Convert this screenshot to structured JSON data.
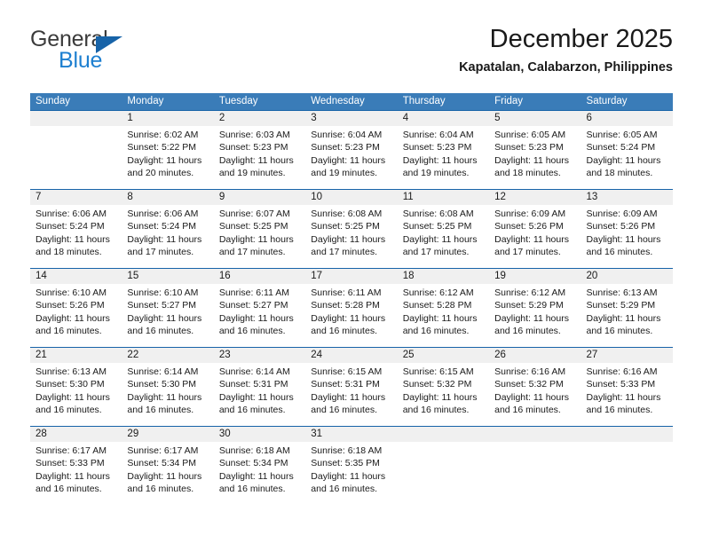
{
  "brand": {
    "name_part1": "General",
    "name_part2": "Blue",
    "logo_icon": "blue-triangle-flag-icon",
    "accent_color": "#1763a8",
    "blue_text_color": "#1d7fd0"
  },
  "header": {
    "title": "December 2025",
    "subtitle": "Kapatalan, Calabarzon, Philippines"
  },
  "calendar": {
    "header_bg_color": "#3a7cb8",
    "row_divider_color": "#1763a8",
    "daynum_bg_color": "#f0f0f0",
    "weekdays": [
      "Sunday",
      "Monday",
      "Tuesday",
      "Wednesday",
      "Thursday",
      "Friday",
      "Saturday"
    ],
    "weeks": [
      [
        {
          "day": "",
          "sunrise": "",
          "sunset": "",
          "daylight1": "",
          "daylight2": ""
        },
        {
          "day": "1",
          "sunrise": "Sunrise: 6:02 AM",
          "sunset": "Sunset: 5:22 PM",
          "daylight1": "Daylight: 11 hours",
          "daylight2": "and 20 minutes."
        },
        {
          "day": "2",
          "sunrise": "Sunrise: 6:03 AM",
          "sunset": "Sunset: 5:23 PM",
          "daylight1": "Daylight: 11 hours",
          "daylight2": "and 19 minutes."
        },
        {
          "day": "3",
          "sunrise": "Sunrise: 6:04 AM",
          "sunset": "Sunset: 5:23 PM",
          "daylight1": "Daylight: 11 hours",
          "daylight2": "and 19 minutes."
        },
        {
          "day": "4",
          "sunrise": "Sunrise: 6:04 AM",
          "sunset": "Sunset: 5:23 PM",
          "daylight1": "Daylight: 11 hours",
          "daylight2": "and 19 minutes."
        },
        {
          "day": "5",
          "sunrise": "Sunrise: 6:05 AM",
          "sunset": "Sunset: 5:23 PM",
          "daylight1": "Daylight: 11 hours",
          "daylight2": "and 18 minutes."
        },
        {
          "day": "6",
          "sunrise": "Sunrise: 6:05 AM",
          "sunset": "Sunset: 5:24 PM",
          "daylight1": "Daylight: 11 hours",
          "daylight2": "and 18 minutes."
        }
      ],
      [
        {
          "day": "7",
          "sunrise": "Sunrise: 6:06 AM",
          "sunset": "Sunset: 5:24 PM",
          "daylight1": "Daylight: 11 hours",
          "daylight2": "and 18 minutes."
        },
        {
          "day": "8",
          "sunrise": "Sunrise: 6:06 AM",
          "sunset": "Sunset: 5:24 PM",
          "daylight1": "Daylight: 11 hours",
          "daylight2": "and 17 minutes."
        },
        {
          "day": "9",
          "sunrise": "Sunrise: 6:07 AM",
          "sunset": "Sunset: 5:25 PM",
          "daylight1": "Daylight: 11 hours",
          "daylight2": "and 17 minutes."
        },
        {
          "day": "10",
          "sunrise": "Sunrise: 6:08 AM",
          "sunset": "Sunset: 5:25 PM",
          "daylight1": "Daylight: 11 hours",
          "daylight2": "and 17 minutes."
        },
        {
          "day": "11",
          "sunrise": "Sunrise: 6:08 AM",
          "sunset": "Sunset: 5:25 PM",
          "daylight1": "Daylight: 11 hours",
          "daylight2": "and 17 minutes."
        },
        {
          "day": "12",
          "sunrise": "Sunrise: 6:09 AM",
          "sunset": "Sunset: 5:26 PM",
          "daylight1": "Daylight: 11 hours",
          "daylight2": "and 17 minutes."
        },
        {
          "day": "13",
          "sunrise": "Sunrise: 6:09 AM",
          "sunset": "Sunset: 5:26 PM",
          "daylight1": "Daylight: 11 hours",
          "daylight2": "and 16 minutes."
        }
      ],
      [
        {
          "day": "14",
          "sunrise": "Sunrise: 6:10 AM",
          "sunset": "Sunset: 5:26 PM",
          "daylight1": "Daylight: 11 hours",
          "daylight2": "and 16 minutes."
        },
        {
          "day": "15",
          "sunrise": "Sunrise: 6:10 AM",
          "sunset": "Sunset: 5:27 PM",
          "daylight1": "Daylight: 11 hours",
          "daylight2": "and 16 minutes."
        },
        {
          "day": "16",
          "sunrise": "Sunrise: 6:11 AM",
          "sunset": "Sunset: 5:27 PM",
          "daylight1": "Daylight: 11 hours",
          "daylight2": "and 16 minutes."
        },
        {
          "day": "17",
          "sunrise": "Sunrise: 6:11 AM",
          "sunset": "Sunset: 5:28 PM",
          "daylight1": "Daylight: 11 hours",
          "daylight2": "and 16 minutes."
        },
        {
          "day": "18",
          "sunrise": "Sunrise: 6:12 AM",
          "sunset": "Sunset: 5:28 PM",
          "daylight1": "Daylight: 11 hours",
          "daylight2": "and 16 minutes."
        },
        {
          "day": "19",
          "sunrise": "Sunrise: 6:12 AM",
          "sunset": "Sunset: 5:29 PM",
          "daylight1": "Daylight: 11 hours",
          "daylight2": "and 16 minutes."
        },
        {
          "day": "20",
          "sunrise": "Sunrise: 6:13 AM",
          "sunset": "Sunset: 5:29 PM",
          "daylight1": "Daylight: 11 hours",
          "daylight2": "and 16 minutes."
        }
      ],
      [
        {
          "day": "21",
          "sunrise": "Sunrise: 6:13 AM",
          "sunset": "Sunset: 5:30 PM",
          "daylight1": "Daylight: 11 hours",
          "daylight2": "and 16 minutes."
        },
        {
          "day": "22",
          "sunrise": "Sunrise: 6:14 AM",
          "sunset": "Sunset: 5:30 PM",
          "daylight1": "Daylight: 11 hours",
          "daylight2": "and 16 minutes."
        },
        {
          "day": "23",
          "sunrise": "Sunrise: 6:14 AM",
          "sunset": "Sunset: 5:31 PM",
          "daylight1": "Daylight: 11 hours",
          "daylight2": "and 16 minutes."
        },
        {
          "day": "24",
          "sunrise": "Sunrise: 6:15 AM",
          "sunset": "Sunset: 5:31 PM",
          "daylight1": "Daylight: 11 hours",
          "daylight2": "and 16 minutes."
        },
        {
          "day": "25",
          "sunrise": "Sunrise: 6:15 AM",
          "sunset": "Sunset: 5:32 PM",
          "daylight1": "Daylight: 11 hours",
          "daylight2": "and 16 minutes."
        },
        {
          "day": "26",
          "sunrise": "Sunrise: 6:16 AM",
          "sunset": "Sunset: 5:32 PM",
          "daylight1": "Daylight: 11 hours",
          "daylight2": "and 16 minutes."
        },
        {
          "day": "27",
          "sunrise": "Sunrise: 6:16 AM",
          "sunset": "Sunset: 5:33 PM",
          "daylight1": "Daylight: 11 hours",
          "daylight2": "and 16 minutes."
        }
      ],
      [
        {
          "day": "28",
          "sunrise": "Sunrise: 6:17 AM",
          "sunset": "Sunset: 5:33 PM",
          "daylight1": "Daylight: 11 hours",
          "daylight2": "and 16 minutes."
        },
        {
          "day": "29",
          "sunrise": "Sunrise: 6:17 AM",
          "sunset": "Sunset: 5:34 PM",
          "daylight1": "Daylight: 11 hours",
          "daylight2": "and 16 minutes."
        },
        {
          "day": "30",
          "sunrise": "Sunrise: 6:18 AM",
          "sunset": "Sunset: 5:34 PM",
          "daylight1": "Daylight: 11 hours",
          "daylight2": "and 16 minutes."
        },
        {
          "day": "31",
          "sunrise": "Sunrise: 6:18 AM",
          "sunset": "Sunset: 5:35 PM",
          "daylight1": "Daylight: 11 hours",
          "daylight2": "and 16 minutes."
        },
        {
          "day": "",
          "sunrise": "",
          "sunset": "",
          "daylight1": "",
          "daylight2": ""
        },
        {
          "day": "",
          "sunrise": "",
          "sunset": "",
          "daylight1": "",
          "daylight2": ""
        },
        {
          "day": "",
          "sunrise": "",
          "sunset": "",
          "daylight1": "",
          "daylight2": ""
        }
      ]
    ]
  }
}
